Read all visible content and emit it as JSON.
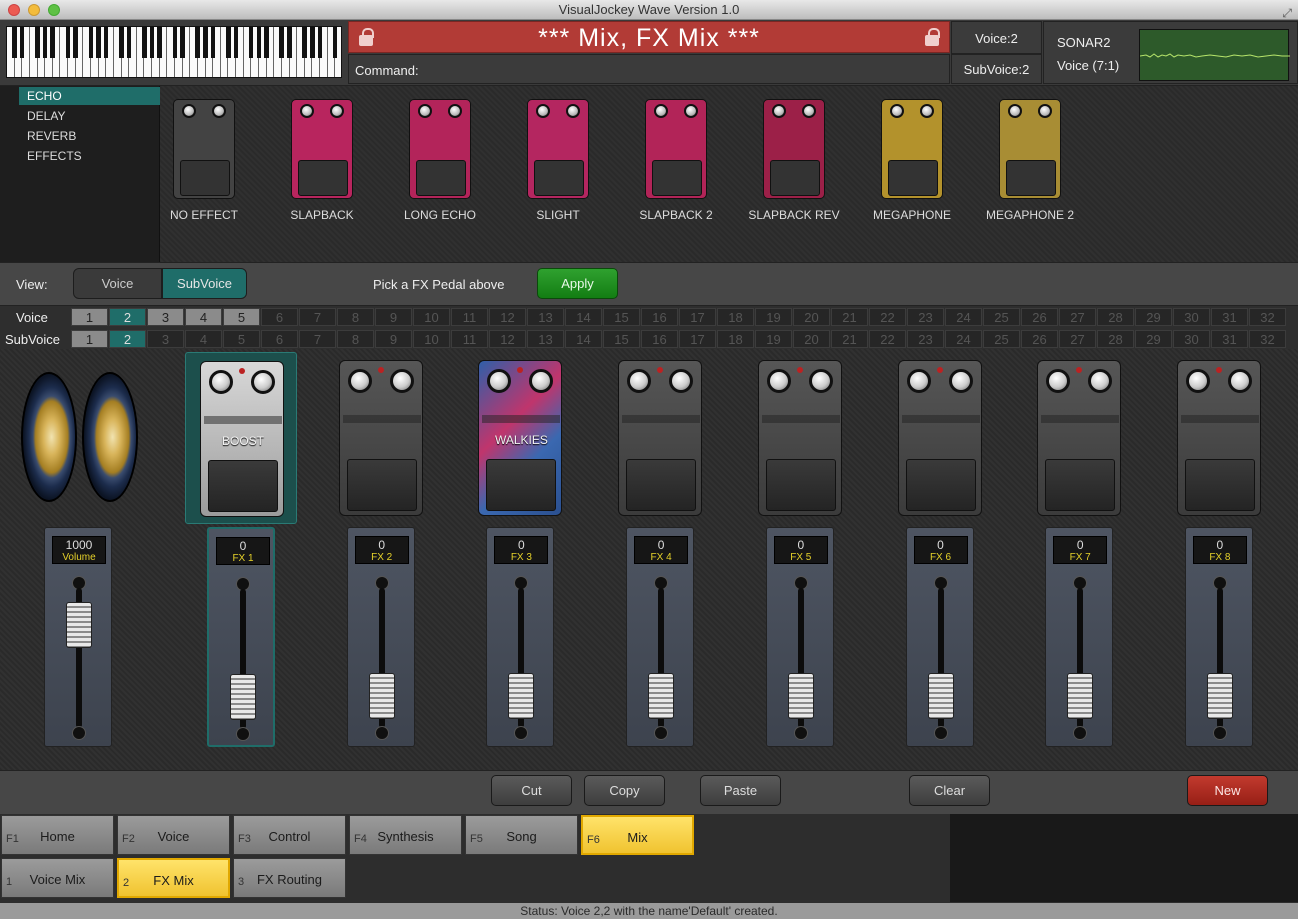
{
  "window": {
    "title": "VisualJockey Wave Version 1.0"
  },
  "header": {
    "banner_title": "*** Mix, FX Mix ***",
    "command_label": "Command:",
    "voice": "Voice:2",
    "subvoice": "SubVoice:2",
    "sonar_name": "SONAR2",
    "sonar_voice": "Voice (7:1)"
  },
  "fx_categories": [
    "ECHO",
    "DELAY",
    "REVERB",
    "EFFECTS"
  ],
  "fx_selected_category": "ECHO",
  "fx_pedals": [
    "NO EFFECT",
    "SLAPBACK",
    "LONG ECHO",
    "SLIGHT",
    "SLAPBACK 2",
    "SLAPBACK REV",
    "MEGAPHONE",
    "MEGAPHONE 2"
  ],
  "viewbar": {
    "view_label": "View:",
    "voice_btn": "Voice",
    "subvoice_btn": "SubVoice",
    "selected_view": "SubVoice",
    "hint": "Pick a FX Pedal above",
    "apply_btn": "Apply"
  },
  "grid": {
    "voice_label": "Voice",
    "subvoice_label": "SubVoice",
    "numbers": [
      "1",
      "2",
      "3",
      "4",
      "5",
      "6",
      "7",
      "8",
      "9",
      "10",
      "11",
      "12",
      "13",
      "14",
      "15",
      "16",
      "17",
      "18",
      "19",
      "20",
      "21",
      "22",
      "23",
      "24",
      "25",
      "26",
      "27",
      "28",
      "29",
      "30",
      "31",
      "32"
    ],
    "voice_available": 5,
    "voice_selected": 2,
    "subvoice_available": 2,
    "subvoice_selected": 2
  },
  "mixer": {
    "volume": {
      "value": "1000",
      "label": "Volume",
      "level": 0.85
    },
    "slots": [
      {
        "pedal": "BOOST",
        "value": "0",
        "label": "FX 1",
        "level": 0.1,
        "selected": true
      },
      {
        "pedal": "",
        "value": "0",
        "label": "FX 2",
        "level": 0.1
      },
      {
        "pedal": "WALKIES",
        "value": "0",
        "label": "FX 3",
        "level": 0.1
      },
      {
        "pedal": "",
        "value": "0",
        "label": "FX 4",
        "level": 0.1
      },
      {
        "pedal": "",
        "value": "0",
        "label": "FX 5",
        "level": 0.1
      },
      {
        "pedal": "",
        "value": "0",
        "label": "FX 6",
        "level": 0.1
      },
      {
        "pedal": "",
        "value": "0",
        "label": "FX 7",
        "level": 0.1
      },
      {
        "pedal": "",
        "value": "0",
        "label": "FX 8",
        "level": 0.1
      }
    ]
  },
  "toolbar": {
    "cut": "Cut",
    "copy": "Copy",
    "paste": "Paste",
    "clear": "Clear",
    "new": "New"
  },
  "function_tabs": [
    {
      "key": "F1",
      "label": "Home"
    },
    {
      "key": "F2",
      "label": "Voice"
    },
    {
      "key": "F3",
      "label": "Control"
    },
    {
      "key": "F4",
      "label": "Synthesis"
    },
    {
      "key": "F5",
      "label": "Song"
    },
    {
      "key": "F6",
      "label": "Mix"
    }
  ],
  "active_function_tab": "Mix",
  "sub_tabs": [
    {
      "key": "1",
      "label": "Voice Mix"
    },
    {
      "key": "2",
      "label": "FX Mix"
    },
    {
      "key": "3",
      "label": "FX Routing"
    }
  ],
  "active_sub_tab": "FX Mix",
  "status": "Status: Voice 2,2 with the name'Default' created.",
  "colors": {
    "accent": "#1f6d69",
    "banner": "#b23b36",
    "apply": "#1f8f1f",
    "new": "#b12c22",
    "active_tab": "#f7d44c",
    "fx_label": "#e6d22a"
  }
}
